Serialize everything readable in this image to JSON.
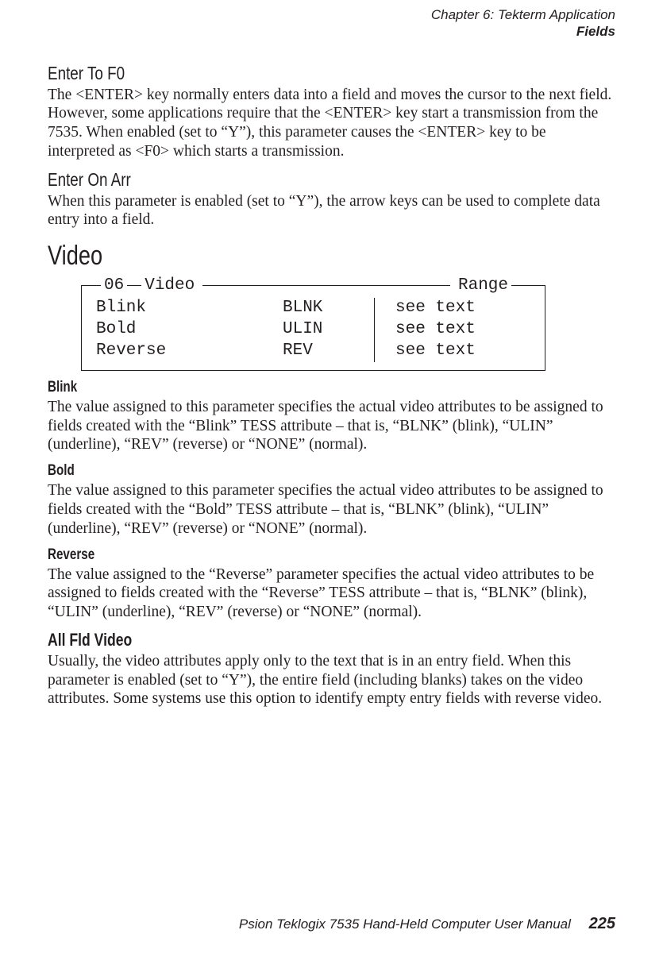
{
  "header": {
    "chapter": "Chapter 6: Tekterm Application",
    "section": "Fields"
  },
  "s1": {
    "title": "Enter To F0",
    "body": "The <ENTER> key normally enters data into a field and moves the cursor to the next field. However, some applications require that the <ENTER> key start a transmission from the 7535. When enabled (set to “Y”), this parameter causes the <ENTER> key to be interpreted as <F0> which starts a transmission."
  },
  "s2": {
    "title": "Enter On Arr",
    "body": "When this parameter is enabled (set to “Y”), the arrow keys can be used to complete data entry into a field."
  },
  "video": {
    "title": "Video",
    "legend_left": "06",
    "legend_mid": "Video",
    "legend_right": "Range",
    "rows": [
      {
        "name": "Blink",
        "val": "BLNK",
        "range": "see text"
      },
      {
        "name": "Bold",
        "val": "ULIN",
        "range": "see text"
      },
      {
        "name": "Reverse",
        "val": "REV",
        "range": "see text"
      }
    ]
  },
  "blink": {
    "title": "Blink",
    "body": "The value assigned to this parameter specifies the actual video attributes to be assigned to fields created with the “Blink” TESS attribute – that is, “BLNK” (blink), “ULIN” (underline), “REV” (reverse) or “NONE” (normal)."
  },
  "bold": {
    "title": "Bold",
    "body": "The value assigned to this parameter specifies the actual video attributes to be assigned to fields created with the “Bold” TESS attribute – that is, “BLNK” (blink), “ULIN” (underline), “REV” (reverse) or “NONE” (normal)."
  },
  "reverse": {
    "title": "Reverse",
    "body": "The value assigned to the “Reverse” parameter specifies the actual video attributes to be assigned to fields created with the “Reverse” TESS attribute – that is, “BLNK” (blink), “ULIN” (underline), “REV” (reverse) or “NONE” (normal)."
  },
  "allfld": {
    "title": "All Fld Video",
    "body": "Usually, the video attributes apply only to the text that is in an entry field. When this parameter is enabled (set to “Y”), the entire field (including blanks) takes on the video attributes. Some systems use this option to identify empty entry fields with reverse video."
  },
  "footer": {
    "book": "Psion Teklogix 7535 Hand-Held Computer User Manual",
    "page": "225"
  }
}
